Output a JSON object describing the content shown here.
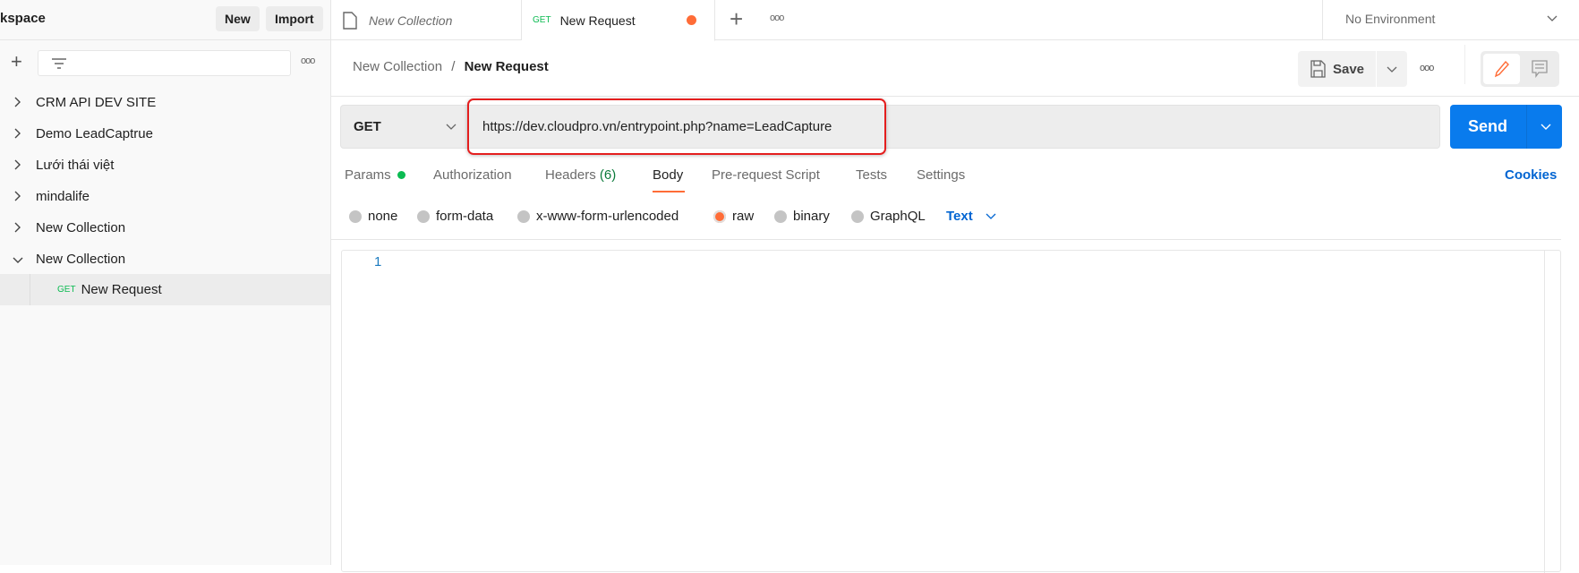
{
  "sidebar": {
    "workspace_title": "kspace",
    "new_label": "New",
    "import_label": "Import",
    "items": [
      {
        "label": "CRM API DEV SITE",
        "expanded": false
      },
      {
        "label": "Demo LeadCaptrue",
        "expanded": false
      },
      {
        "label": "Lưới thái việt",
        "expanded": false
      },
      {
        "label": "mindalife",
        "expanded": false
      },
      {
        "label": "New Collection",
        "expanded": false
      },
      {
        "label": "New Collection",
        "expanded": true
      }
    ],
    "child": {
      "method": "GET",
      "label": "New Request"
    }
  },
  "tabs": [
    {
      "label": "New Collection",
      "icon": "collection-icon"
    },
    {
      "method": "GET",
      "label": "New Request",
      "unsaved": true
    }
  ],
  "environment": "No Environment",
  "breadcrumb": {
    "parent": "New Collection",
    "separator": "/",
    "current": "New Request"
  },
  "toolbar": {
    "save_label": "Save"
  },
  "request": {
    "method": "GET",
    "url": "https://dev.cloudpro.vn/entrypoint.php?name=LeadCapture",
    "send_label": "Send"
  },
  "request_tabs": [
    {
      "label": "Params",
      "dot": true
    },
    {
      "label": "Authorization"
    },
    {
      "label": "Headers",
      "count": "(6)"
    },
    {
      "label": "Body",
      "active": true
    },
    {
      "label": "Pre-request Script"
    },
    {
      "label": "Tests"
    },
    {
      "label": "Settings"
    }
  ],
  "cookies_label": "Cookies",
  "body_options": [
    "none",
    "form-data",
    "x-www-form-urlencoded",
    "raw",
    "binary",
    "GraphQL"
  ],
  "body_selected": "raw",
  "body_format": "Text",
  "editor": {
    "line_number": "1"
  },
  "colors": {
    "accent": "#ff6c37",
    "send": "#097bed",
    "link": "#0265d2",
    "get": "#0cbb52",
    "highlight": "#e41e1e"
  }
}
